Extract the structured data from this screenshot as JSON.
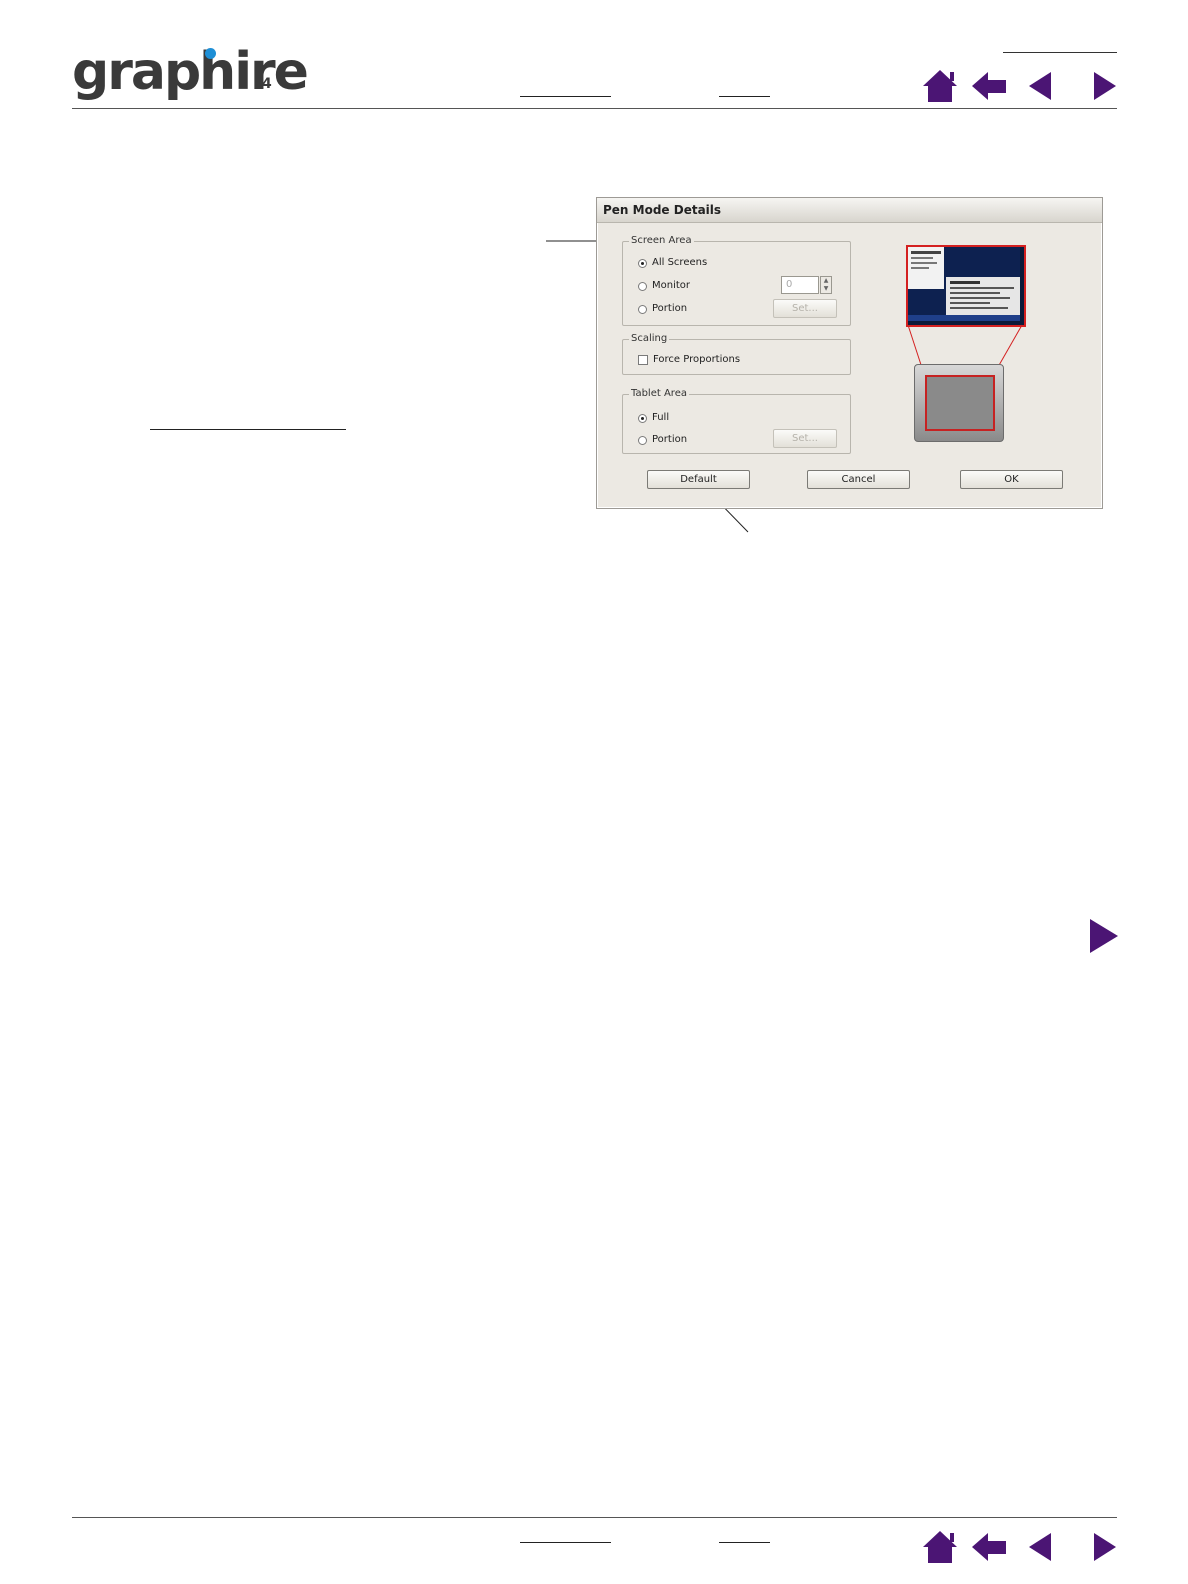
{
  "header": {
    "logo_text": "graphire",
    "logo_sub": "4"
  },
  "nav_icons": [
    "home-icon",
    "back-icon",
    "previous-page-icon",
    "next-page-icon"
  ],
  "dialog": {
    "title": "Pen Mode Details",
    "screen_area": {
      "legend": "Screen Area",
      "options": [
        "All Screens",
        "Monitor",
        "Portion"
      ],
      "selected": "All Screens",
      "monitor_value": "0",
      "set_button": "Set..."
    },
    "scaling": {
      "legend": "Scaling",
      "force_proportions_label": "Force Proportions",
      "force_proportions_checked": false
    },
    "tablet_area": {
      "legend": "Tablet Area",
      "options": [
        "Full",
        "Portion"
      ],
      "selected": "Full",
      "set_button": "Set..."
    },
    "buttons": {
      "default": "Default",
      "cancel": "Cancel",
      "ok": "OK"
    }
  },
  "colors": {
    "nav_accent": "#4b1574",
    "logo_dot": "#1e8fd6",
    "preview_outline": "#d42020"
  }
}
